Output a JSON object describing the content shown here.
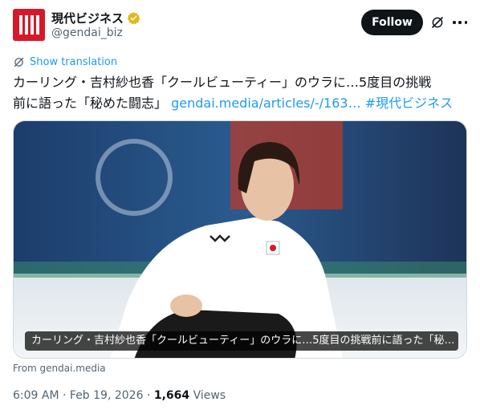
{
  "account": {
    "display_name": "現代ビジネス",
    "handle": "@gendai_biz",
    "verified_badge_color": "#e2b719",
    "avatar_color": "#d7182a"
  },
  "actions": {
    "follow_label": "Follow",
    "grok_icon": "grok-icon",
    "more_icon": "more-icon"
  },
  "translation": {
    "label": "Show translation"
  },
  "tweet": {
    "text_line1": "カーリング・吉村紗也香「クールビューティー」のウラに…5度目の挑戦",
    "text_line2": "前に語った「秘めた闘志」",
    "link": "gendai.media/articles/-/163…",
    "hashtag": "#現代ビジネス"
  },
  "media": {
    "caption": "カーリング・吉村紗也香「クールビューティー」のウラに…5度目の挑戦前に語った「秘…",
    "source": "From gendai.media"
  },
  "meta": {
    "time": "6:09 AM",
    "separator1": " · ",
    "date": "Feb 19, 2026",
    "separator2": " · ",
    "views_count": "1,664",
    "views_label": " Views"
  },
  "colors": {
    "link": "#1d9bf0",
    "text": "#0f1419",
    "secondary": "#536471"
  }
}
